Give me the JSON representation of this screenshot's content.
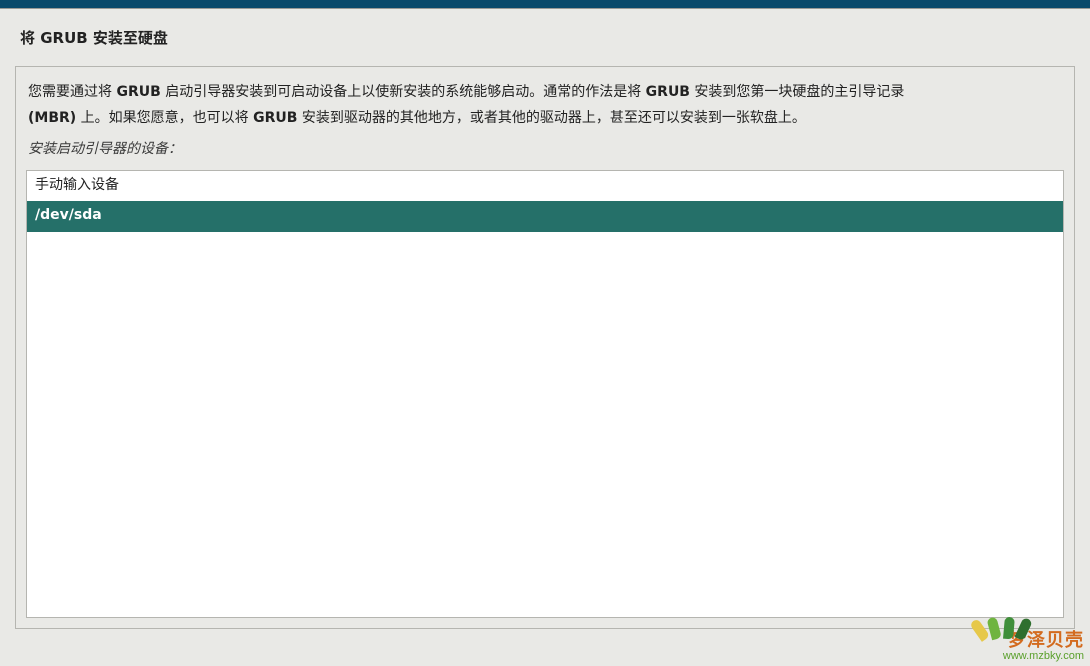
{
  "title": "将 GRUB 安装至硬盘",
  "description_parts": {
    "p1a": "您需要通过将 ",
    "p1b": "GRUB",
    "p1c": " 启动引导器安装到可启动设备上以使新安装的系统能够启动。通常的作法是将 ",
    "p1d": "GRUB",
    "p1e": " 安装到您第一块硬盘的主引导记录",
    "p2a": "(MBR)",
    "p2b": " 上。如果您愿意，也可以将 ",
    "p2c": "GRUB",
    "p2d": " 安装到驱动器的其他地方，或者其他的驱动器上，甚至还可以安装到一张软盘上。"
  },
  "subheading": "安装启动引导器的设备：",
  "devices": {
    "items": [
      {
        "label": "手动输入设备",
        "selected": false
      },
      {
        "label": "/dev/sda",
        "selected": true
      }
    ]
  },
  "watermark": {
    "title": "梦泽贝壳",
    "url": "www.mzbky.com"
  }
}
